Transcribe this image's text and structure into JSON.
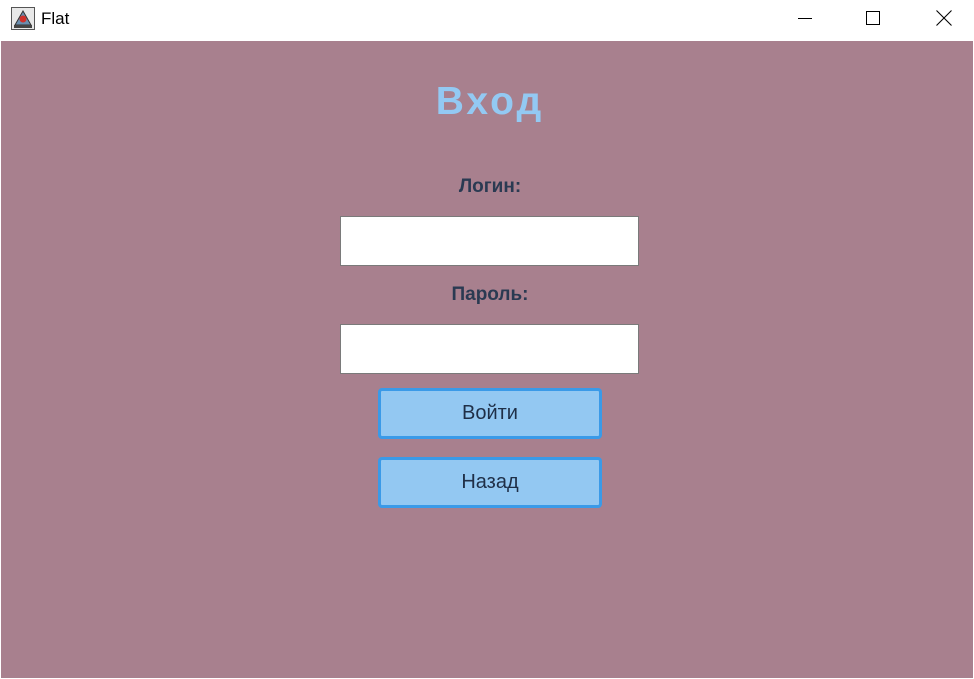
{
  "window": {
    "title": "Flat",
    "icon": "java-app-icon",
    "controls": [
      "minimize-icon",
      "maximize-icon",
      "close-icon"
    ]
  },
  "form": {
    "heading": "Вход",
    "login_label": "Логин:",
    "login_value": "",
    "password_label": "Пароль:",
    "password_value": "",
    "submit_label": "Войти",
    "back_label": "Назад"
  },
  "colors": {
    "background": "#a8808e",
    "heading": "#93c9f3",
    "label": "#2a3a52",
    "button_fill": "#93c8f2",
    "button_border": "#3a9ae8"
  }
}
